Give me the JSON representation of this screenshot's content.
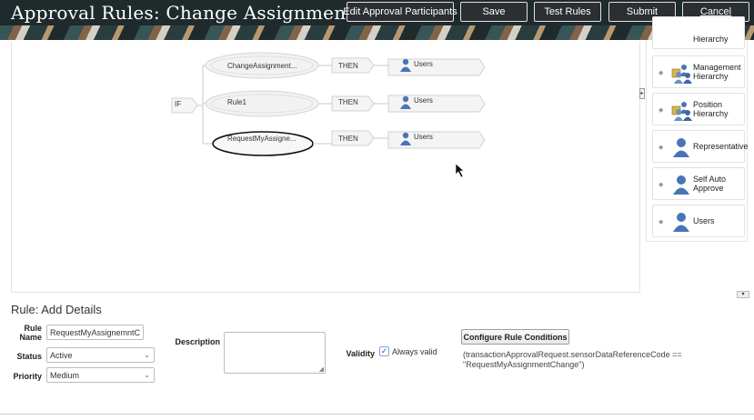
{
  "header": {
    "title": "Approval Rules: Change Assignment: Ch...",
    "buttons": {
      "edit_participants": "Edit Approval Participants",
      "save": "Save",
      "test_rules": "Test Rules",
      "submit": "Submit",
      "cancel": "Cancel"
    }
  },
  "diagram": {
    "if_label": "IF",
    "rules": [
      {
        "name": "ChangeAssignment...",
        "then": "THEN",
        "action": "Users"
      },
      {
        "name": "Rule1",
        "then": "THEN",
        "action": "Users"
      },
      {
        "name": "RequestMyAssigne...",
        "then": "THEN",
        "action": "Users"
      }
    ]
  },
  "palette": {
    "partial_top": "Hierarchy",
    "items": [
      {
        "label": "Management Hierarchy",
        "icon": "hierarchy-users-icon"
      },
      {
        "label": "Position Hierarchy",
        "icon": "hierarchy-users-icon"
      },
      {
        "label": "Representative",
        "icon": "user-icon"
      },
      {
        "label": "Self Auto Approve",
        "icon": "user-icon"
      },
      {
        "label": "Users",
        "icon": "user-icon"
      }
    ]
  },
  "details": {
    "section_title": "Rule: Add Details",
    "rule_name_label": "Rule Name",
    "rule_name_value": "RequestMyAssignemntC",
    "status_label": "Status",
    "status_value": "Active",
    "priority_label": "Priority",
    "priority_value": "Medium",
    "description_label": "Description",
    "validity_label": "Validity",
    "always_valid_label": "Always valid",
    "configure_button": "Configure Rule Conditions",
    "condition_text": "(transactionApprovalRequest.sensorDataReferenceCode == \"RequestMyAssignmentChange\")"
  },
  "colors": {
    "header_bg": "#1f2a2d",
    "selected_outline": "#111111",
    "user_icon": "#4a74b8"
  }
}
